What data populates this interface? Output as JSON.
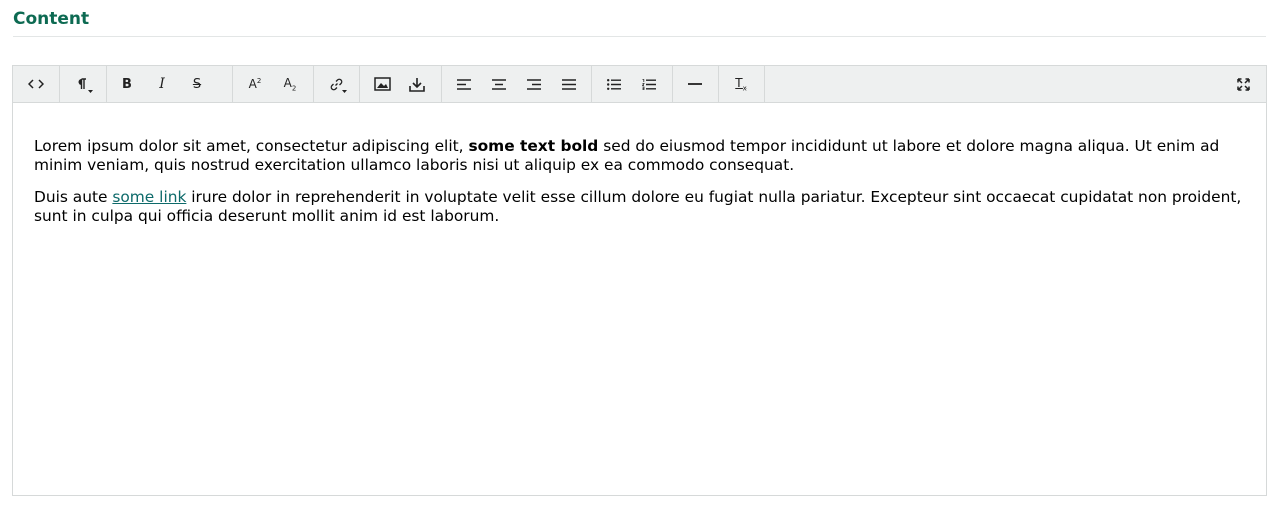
{
  "section": {
    "title": "Content"
  },
  "toolbar": {
    "buttons": [
      {
        "name": "source-code",
        "icon": "code-icon"
      },
      {
        "name": "paragraph-format",
        "icon": "pilcrow-icon"
      },
      {
        "name": "bold",
        "label": "B"
      },
      {
        "name": "italic",
        "label": "I"
      },
      {
        "name": "strikethrough",
        "label": "S"
      },
      {
        "name": "superscript",
        "label": "A²"
      },
      {
        "name": "subscript",
        "label": "A₂"
      },
      {
        "name": "insert-link",
        "icon": "link-icon"
      },
      {
        "name": "insert-image",
        "icon": "image-icon"
      },
      {
        "name": "insert-file",
        "icon": "download-icon"
      },
      {
        "name": "align-left",
        "icon": "align-left-icon"
      },
      {
        "name": "align-center",
        "icon": "align-center-icon"
      },
      {
        "name": "align-right",
        "icon": "align-right-icon"
      },
      {
        "name": "align-justify",
        "icon": "align-justify-icon"
      },
      {
        "name": "bulleted-list",
        "icon": "bullet-list-icon"
      },
      {
        "name": "numbered-list",
        "icon": "numbered-list-icon"
      },
      {
        "name": "horizontal-rule",
        "icon": "horizontal-line-icon"
      },
      {
        "name": "clear-formatting",
        "label": "Tx"
      },
      {
        "name": "fullscreen",
        "icon": "expand-icon"
      }
    ],
    "spellcheck_color": "#d40000"
  },
  "body": {
    "p1_before": "Lorem ipsum dolor sit amet, consectetur adipiscing elit, ",
    "p1_bold": "some text bold",
    "p1_after": " sed do eiusmod tempor incididunt ut labore et dolore magna aliqua. Ut enim ad minim veniam, quis nostrud exercitation ullamco laboris nisi ut aliquip ex ea commodo consequat.",
    "p2_before": "Duis aute ",
    "p2_link": "some link",
    "p2_after": " irure dolor in reprehenderit in voluptate velit esse cillum dolore eu fugiat nulla pariatur. Excepteur sint occaecat cupidatat non proident, sunt in culpa qui officia deserunt mollit anim id est laborum."
  },
  "colors": {
    "accent": "#0d6a52",
    "link": "#0d6a6a",
    "toolbar_bg": "#eef0f0",
    "border": "#d6d9d9"
  }
}
